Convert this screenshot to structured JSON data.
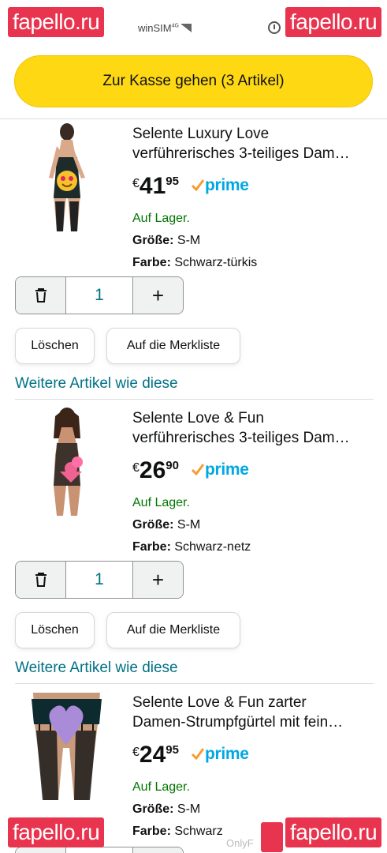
{
  "status": {
    "carrier": "winSIM",
    "network": "4G"
  },
  "watermarks": {
    "brand": "fapello.ru",
    "partial": "OnlyF"
  },
  "checkout": {
    "label": "Zur Kasse gehen (3 Artikel)"
  },
  "colors": {
    "checkout_bg": "#ffd814",
    "link": "#007185",
    "in_stock": "#007600",
    "prime": "#00a8e1",
    "prime_check": "#f79c34"
  },
  "cart": {
    "items": [
      {
        "title_line1": "Selente Luxury Love",
        "title_line2": "verführerisches 3-teiliges Dam…",
        "currency": "€",
        "price_whole": "41",
        "price_frac": "95",
        "prime": "prime",
        "stock": "Auf Lager.",
        "size_label": "Größe:",
        "size_value": "S-M",
        "color_label": "Farbe:",
        "color_value": "Schwarz-türkis",
        "quantity": "1",
        "delete_label": "Löschen",
        "save_label": "Auf die Merkliste",
        "more_label": "Weitere Artikel wie diese",
        "trash_icon": "trash-icon",
        "plus_icon": "plus-icon"
      },
      {
        "title_line1": "Selente Love & Fun",
        "title_line2": "verführerisches 3-teiliges Dam…",
        "currency": "€",
        "price_whole": "26",
        "price_frac": "90",
        "prime": "prime",
        "stock": "Auf Lager.",
        "size_label": "Größe:",
        "size_value": "S-M",
        "color_label": "Farbe:",
        "color_value": "Schwarz-netz",
        "quantity": "1",
        "delete_label": "Löschen",
        "save_label": "Auf die Merkliste",
        "more_label": "Weitere Artikel wie diese",
        "trash_icon": "trash-icon",
        "plus_icon": "plus-icon"
      },
      {
        "title_line1": "Selente Love & Fun zarter",
        "title_line2": "Damen-Strumpfgürtel mit fein…",
        "currency": "€",
        "price_whole": "24",
        "price_frac": "95",
        "prime": "prime",
        "stock": "Auf Lager.",
        "size_label": "Größe:",
        "size_value": "S-M",
        "color_label": "Farbe:",
        "color_value": "Schwarz"
      }
    ]
  }
}
